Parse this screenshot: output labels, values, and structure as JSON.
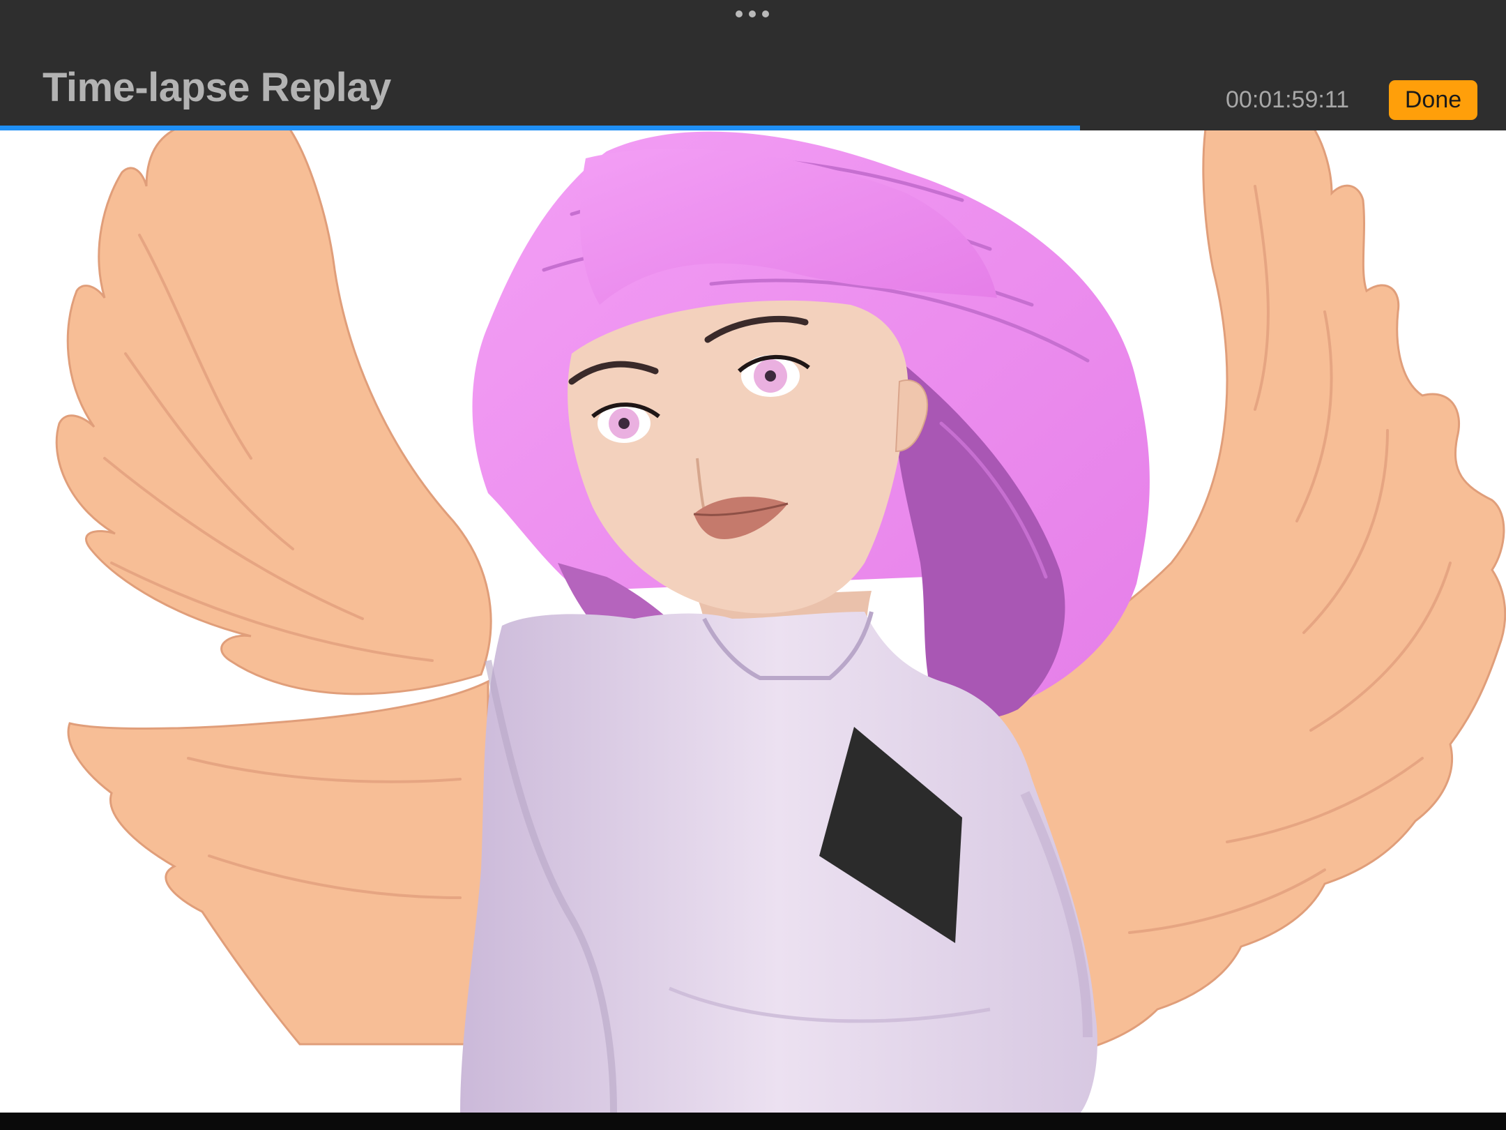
{
  "header": {
    "title": "Time-lapse Replay",
    "timecode": "00:01:59:11",
    "done_label": "Done",
    "accent_color": "#ff9f0a"
  },
  "playback": {
    "progress": 0.717,
    "progress_color": "#1f8ff5"
  },
  "canvas": {
    "artwork": "winged figure with pink hair in a lavender turtleneck",
    "palette": {
      "background": "#ffffff",
      "wings": "#f7be96",
      "hair": "#ee8ff2",
      "hair_shadow": "#a957b4",
      "skin": "#f3d1bd",
      "shirt": "#ece1f1",
      "shirt_shadow": "#bfaed0",
      "diamond": "#2b2b2b",
      "lips": "#c57a6c",
      "eyes": "#eab0e0"
    }
  },
  "icons": {
    "grabber": "more-dots-icon"
  }
}
